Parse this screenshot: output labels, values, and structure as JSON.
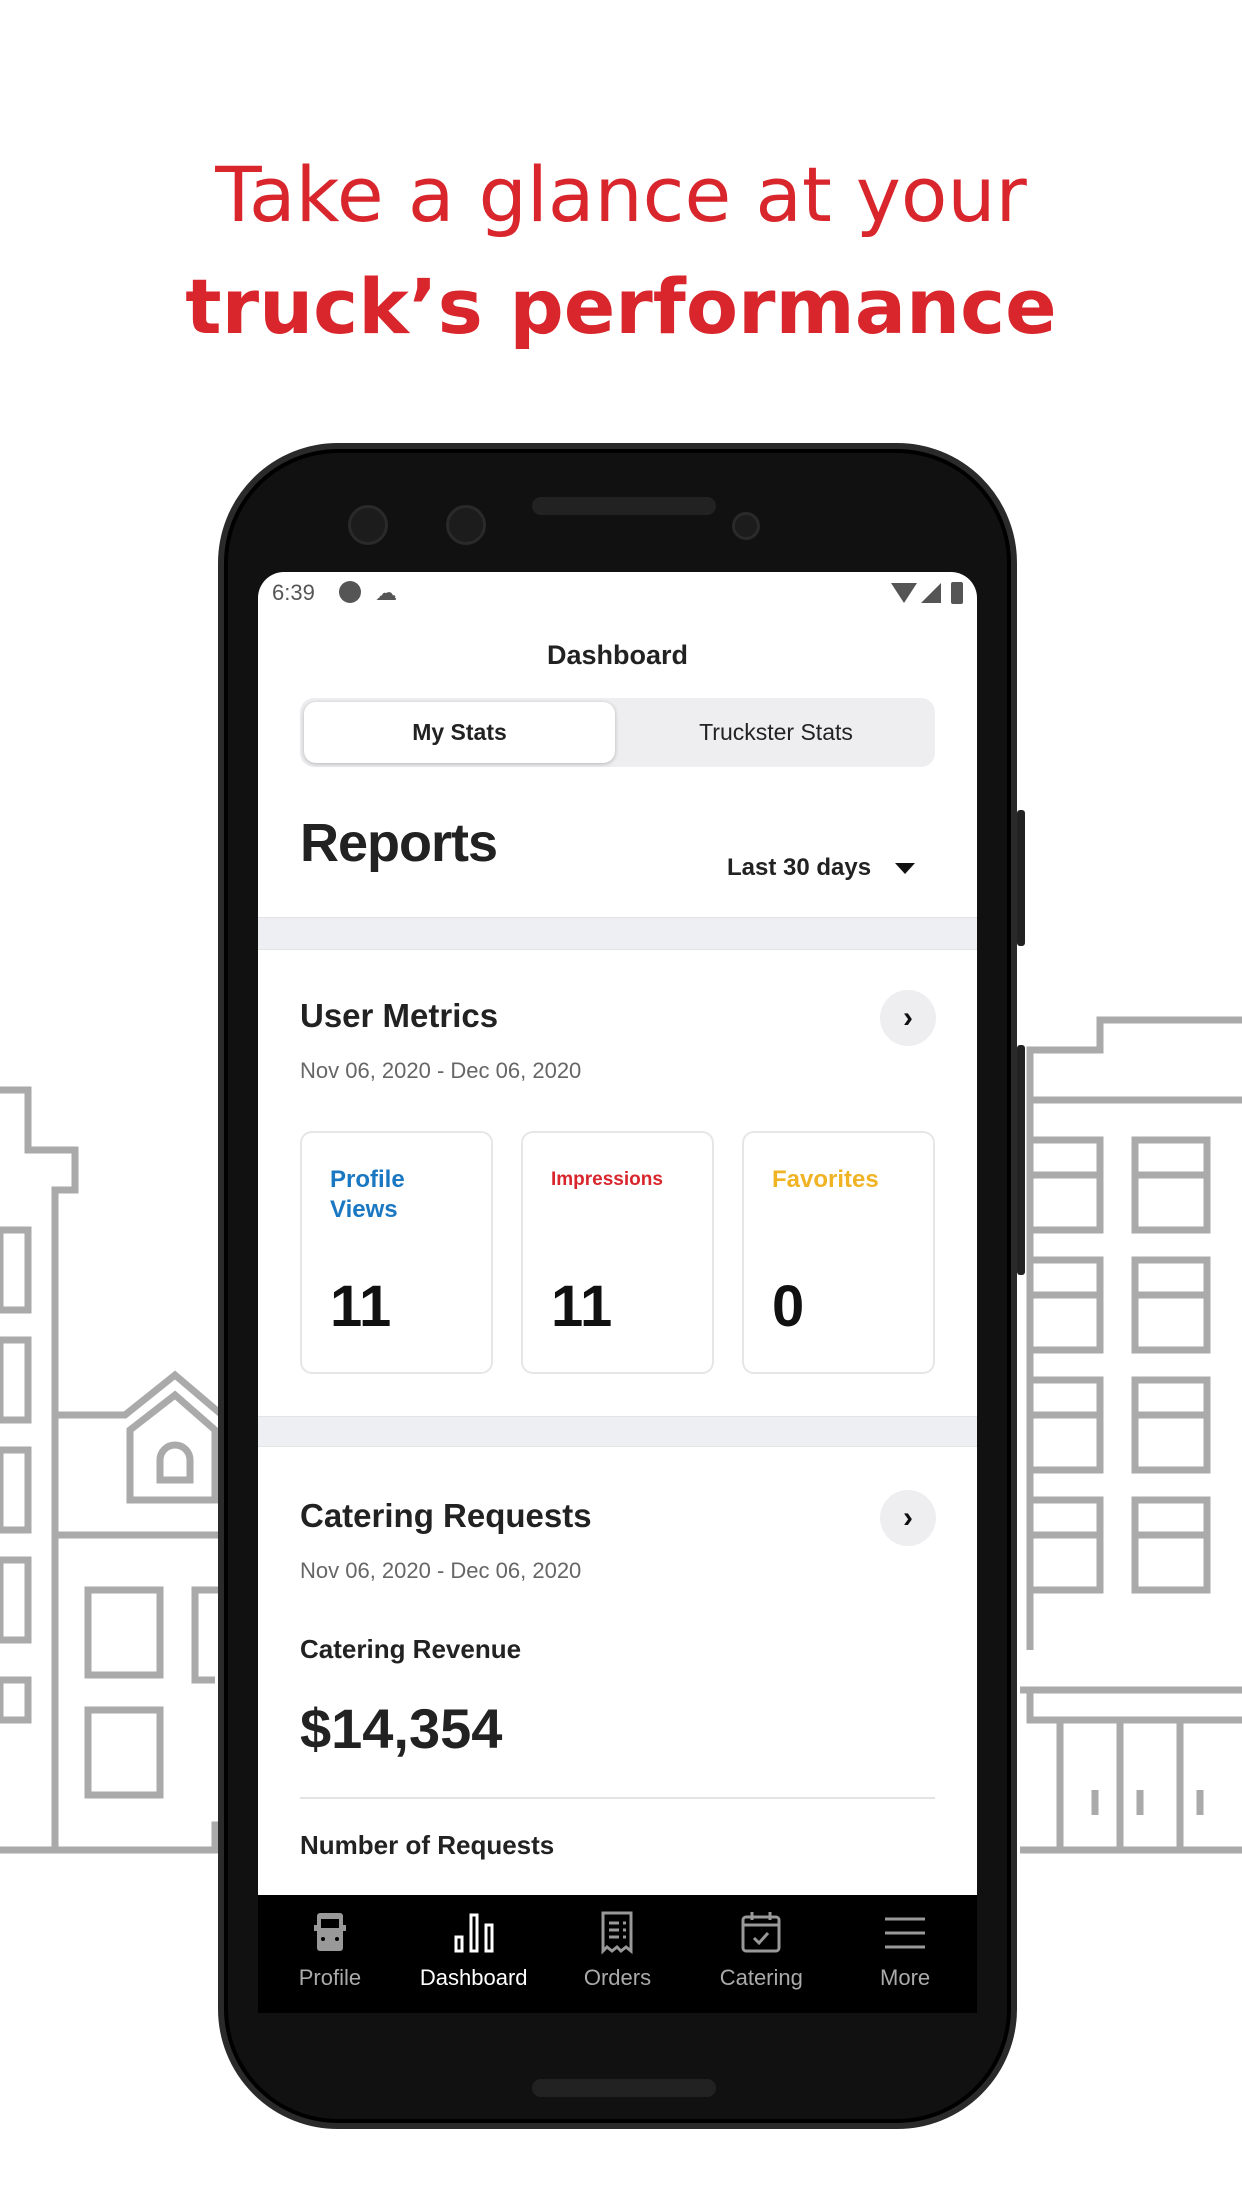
{
  "headline": {
    "line1": "Take a glance at your",
    "line2": "truck’s performance",
    "color": "#d8262c"
  },
  "status_bar": {
    "time": "6:39",
    "icons": [
      "app-icon",
      "cloud-icon",
      "wifi-icon",
      "signal-icon",
      "battery-icon"
    ]
  },
  "header": {
    "title": "Dashboard"
  },
  "tabs": [
    {
      "label": "My Stats",
      "selected": true
    },
    {
      "label": "Truckster Stats",
      "selected": false
    }
  ],
  "reports": {
    "title": "Reports",
    "range": "Last 30 days"
  },
  "user_metrics": {
    "title": "User Metrics",
    "date_range": "Nov 06, 2020 - Dec 06, 2020",
    "cards": [
      {
        "label": "Profile Views",
        "value": "11",
        "color": "#1a78c2"
      },
      {
        "label": "Impressions",
        "value": "11",
        "color": "#d8262c"
      },
      {
        "label": "Favorites",
        "value": "0",
        "color": "#f0b323"
      }
    ]
  },
  "catering": {
    "title": "Catering Requests",
    "date_range": "Nov 06, 2020 - Dec 06, 2020",
    "revenue_label": "Catering Revenue",
    "revenue": "$14,354",
    "requests_label": "Number of Requests"
  },
  "nav": [
    {
      "label": "Profile",
      "icon": "truck-icon",
      "active": false
    },
    {
      "label": "Dashboard",
      "icon": "bar-chart-icon",
      "active": true
    },
    {
      "label": "Orders",
      "icon": "receipt-icon",
      "active": false
    },
    {
      "label": "Catering",
      "icon": "calendar-check-icon",
      "active": false
    },
    {
      "label": "More",
      "icon": "menu-icon",
      "active": false
    }
  ]
}
